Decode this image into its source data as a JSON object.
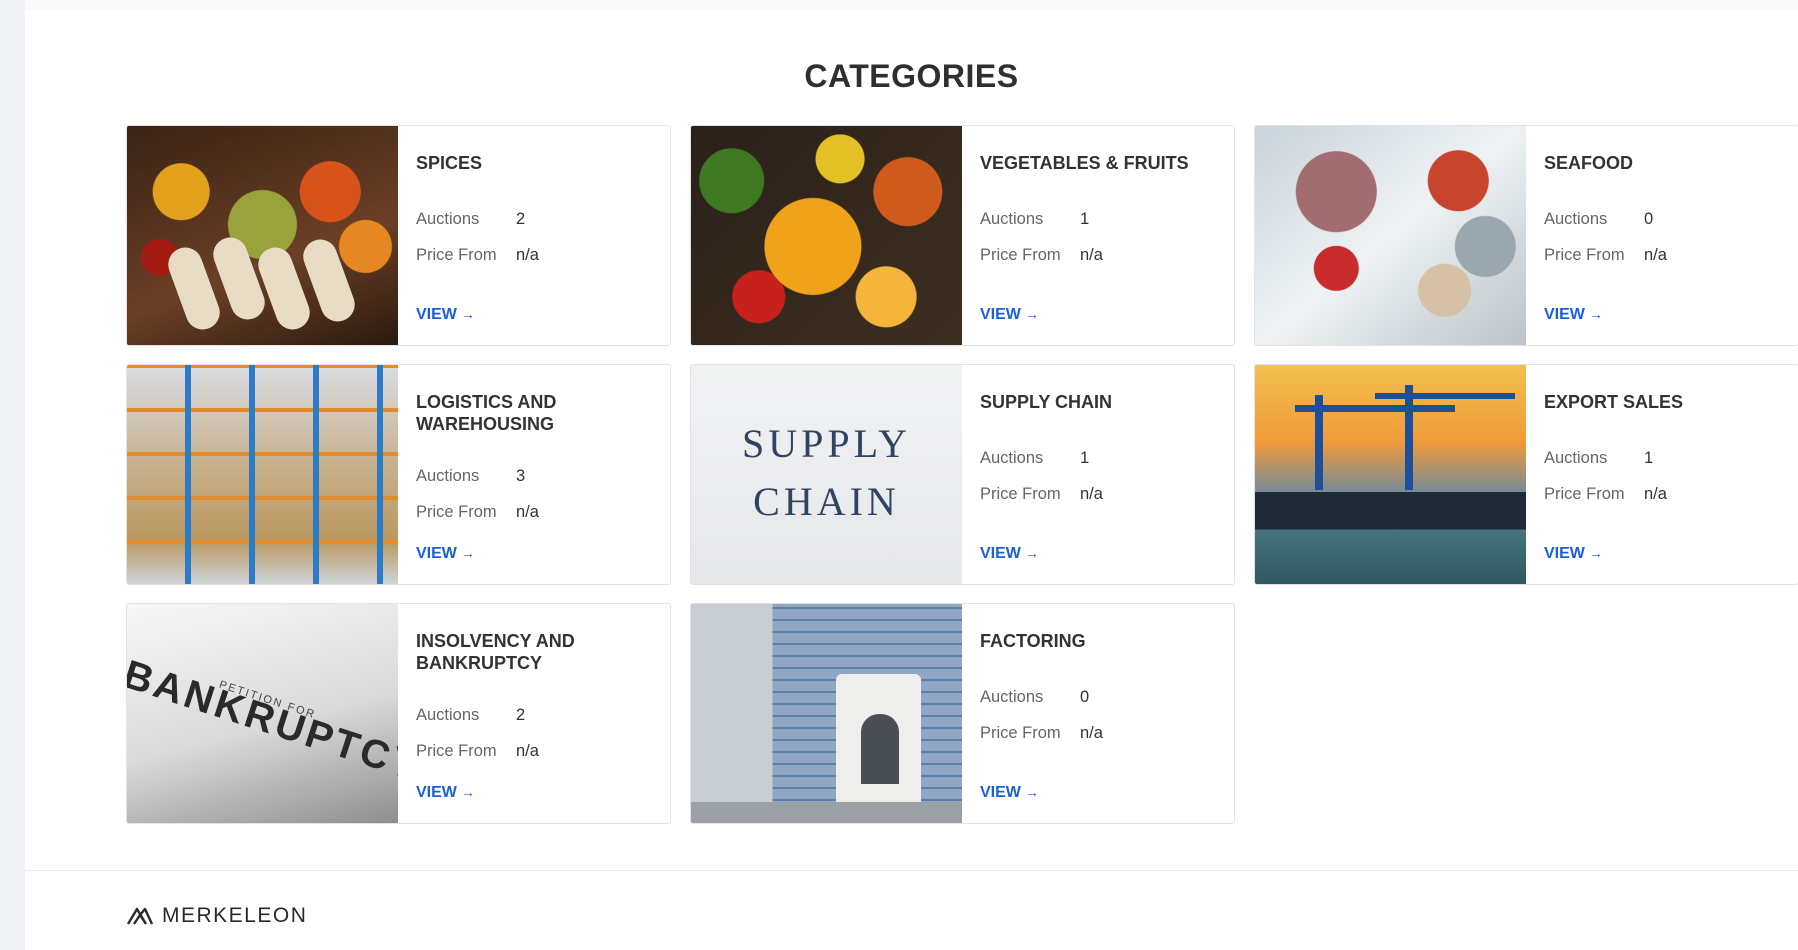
{
  "section_title": "CATEGORIES",
  "labels": {
    "auctions": "Auctions",
    "price_from": "Price From",
    "view": "VIEW"
  },
  "categories": [
    {
      "title": "SPICES",
      "auctions": "2",
      "price_from": "n/a",
      "image": "spices"
    },
    {
      "title": "VEGETABLES & FRUITS",
      "auctions": "1",
      "price_from": "n/a",
      "image": "vegetables"
    },
    {
      "title": "SEAFOOD",
      "auctions": "0",
      "price_from": "n/a",
      "image": "seafood"
    },
    {
      "title": "LOGISTICS AND WAREHOUSING",
      "auctions": "3",
      "price_from": "n/a",
      "image": "warehouse"
    },
    {
      "title": "SUPPLY CHAIN",
      "auctions": "1",
      "price_from": "n/a",
      "image": "supply-chain",
      "image_text": [
        "SUPPLY",
        "CHAIN"
      ]
    },
    {
      "title": "EXPORT SALES",
      "auctions": "1",
      "price_from": "n/a",
      "image": "ship"
    },
    {
      "title": "INSOLVENCY AND BANKRUPTCY",
      "auctions": "2",
      "price_from": "n/a",
      "image": "bankruptcy",
      "image_text": [
        "BANKRUPTCY",
        "PETITION FOR"
      ]
    },
    {
      "title": "FACTORING",
      "auctions": "0",
      "price_from": "n/a",
      "image": "bank"
    }
  ],
  "footer": {
    "brand": "MERKELEON"
  },
  "colors": {
    "link": "#1a5fe0",
    "title": "#2f2f2f"
  }
}
